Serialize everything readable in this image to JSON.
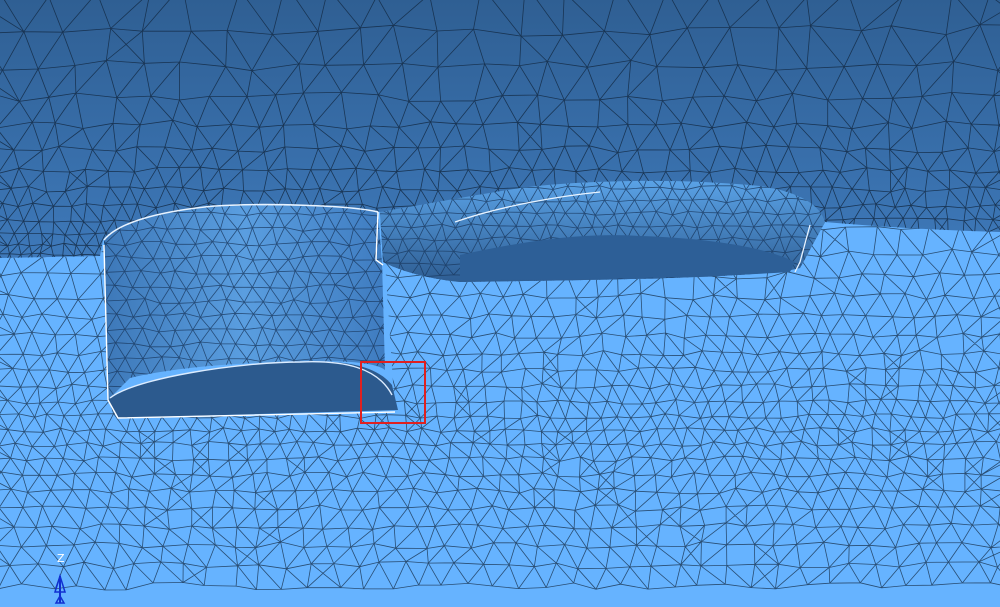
{
  "viewport": {
    "background_color": "#66b3ff",
    "upper_surface_color": "#3a6ea8",
    "mesh_line_color": "#1e3c5c",
    "wall_color": "#4f8fd0",
    "selection_box_color": "#e02020"
  },
  "triad": {
    "z_label": "Z",
    "icon": "coordinate-triad-icon"
  }
}
